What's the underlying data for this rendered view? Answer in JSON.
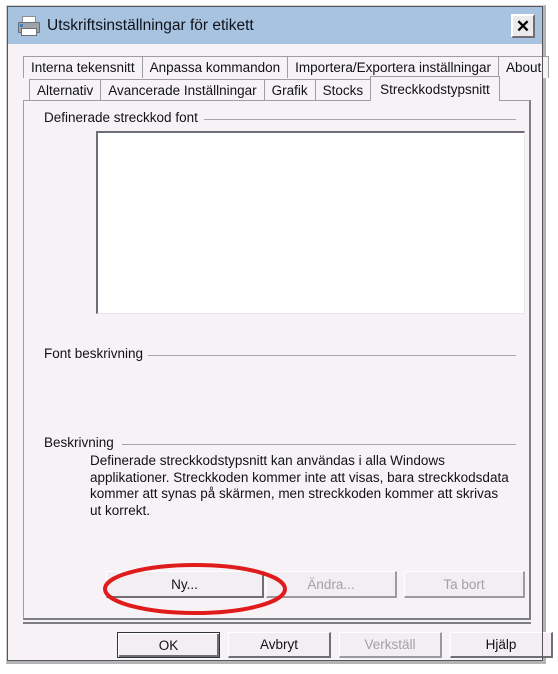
{
  "window": {
    "title": "Utskriftsinställningar för etikett",
    "icon": "printer-icon",
    "close_label": "✕",
    "titlebar_color": "#a8c3e0",
    "background_color": "#f7f2f5"
  },
  "tabs": {
    "row1": [
      {
        "label": "Interna tekensnitt",
        "selected": false
      },
      {
        "label": "Anpassa kommandon",
        "selected": false
      },
      {
        "label": "Importera/Exportera inställningar",
        "selected": false
      },
      {
        "label": "About",
        "selected": false
      }
    ],
    "row2": [
      {
        "label": "Alternativ",
        "selected": false
      },
      {
        "label": "Avancerade Inställningar",
        "selected": false
      },
      {
        "label": "Grafik",
        "selected": false
      },
      {
        "label": "Stocks",
        "selected": false
      },
      {
        "label": "Streckkodstypsnitt",
        "selected": true
      }
    ],
    "selected_tab": "Streckkodstypsnitt"
  },
  "panel": {
    "defined_fonts_group": {
      "label": "Definerade streckkod font",
      "listbox_items": [],
      "listbox_value": ""
    },
    "font_description_group": {
      "label": "Font beskrivning",
      "value": ""
    },
    "description_group": {
      "label": "Beskrivning",
      "text": "Definerade streckkodstypsnitt kan användas i alla Windows applikationer. Streckkoden kommer inte att visas, bara streckkodsdata kommer att synas på skärmen, men streckkoden kommer att skrivas ut korrekt."
    },
    "font_buttons": [
      {
        "label": "Ny...",
        "enabled": true
      },
      {
        "label": "Ändra...",
        "enabled": false
      },
      {
        "label": "Ta bort",
        "enabled": false
      }
    ]
  },
  "dialog_buttons": [
    {
      "label": "OK",
      "enabled": true,
      "default": true
    },
    {
      "label": "Avbryt",
      "enabled": true,
      "default": false
    },
    {
      "label": "Verkställ",
      "enabled": false,
      "default": false
    },
    {
      "label": "Hjälp",
      "enabled": true,
      "default": false
    }
  ],
  "annotation": {
    "shape": "ellipse",
    "color": "#e01b1b",
    "target": "Ny..."
  }
}
